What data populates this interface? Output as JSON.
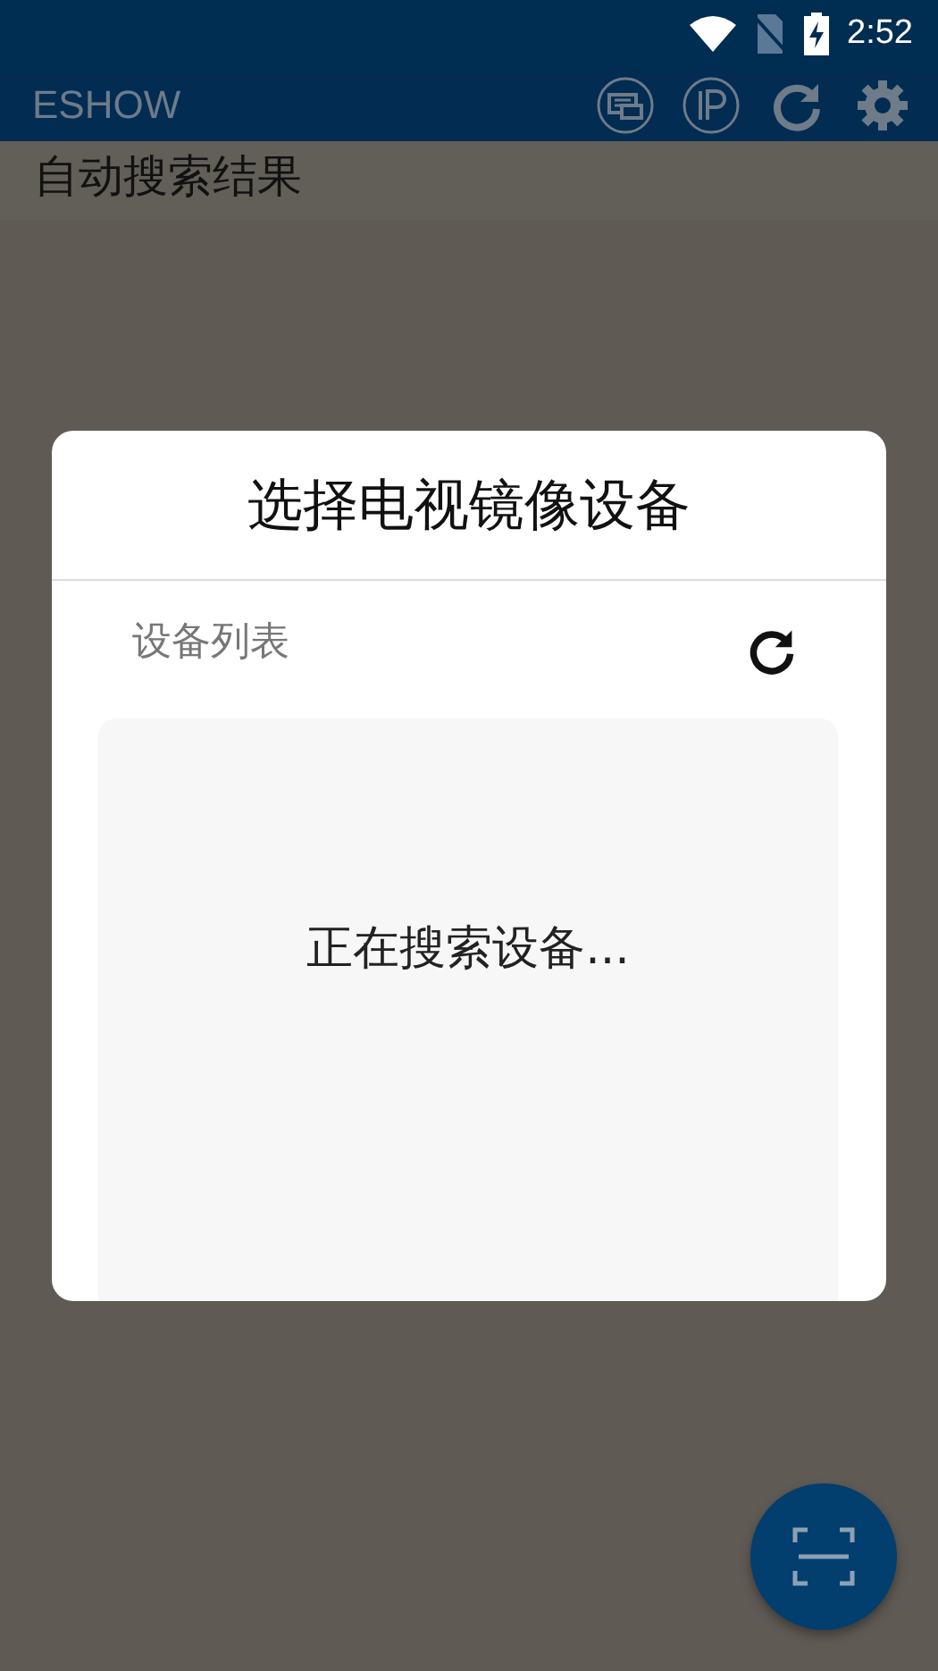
{
  "status_bar": {
    "time": "2:52"
  },
  "app_bar": {
    "title": "ESHOW"
  },
  "section_title": "自动搜索结果",
  "dialog": {
    "title": "选择电视镜像设备",
    "list_label": "设备列表",
    "status": "正在搜索设备..."
  }
}
